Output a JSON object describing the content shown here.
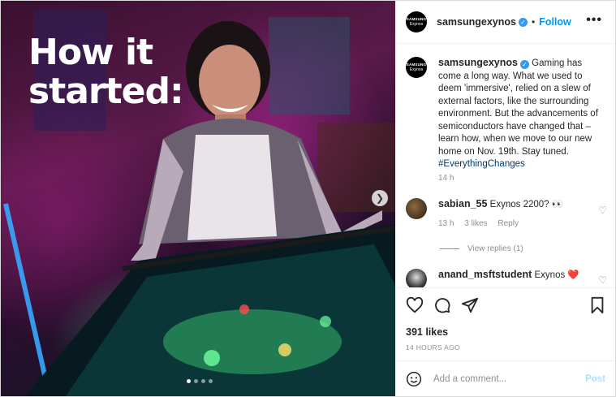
{
  "post": {
    "headline_line1": "How it",
    "headline_line2": "started:",
    "carousel_dots": 4,
    "active_dot": 1
  },
  "header": {
    "avatar_text_top": "SAMSUNG",
    "avatar_text_bottom": "Exynos",
    "username": "samsungexynos",
    "separator": "•",
    "follow_label": "Follow",
    "more_label": "•••"
  },
  "caption": {
    "username": "samsungexynos",
    "text": "Gaming has come a long way. What we used to deem 'immersive', relied on a slew of external factors, like the surrounding environment. But the advancements of semiconductors have changed that – learn how, when we move to our new home on Nov. 19th. Stay tuned.",
    "hashtag": "#EverythingChanges",
    "time": "14 h"
  },
  "comments": [
    {
      "username": "sabian_55",
      "text": "Exynos 2200? 👀",
      "time": "13 h",
      "likes": "3 likes",
      "reply_label": "Reply",
      "view_replies": "View replies (1)"
    },
    {
      "username": "anand_msftstudent",
      "text": "Exynos ❤️"
    }
  ],
  "actions": {
    "likes": "391 likes",
    "posted_ago": "14 HOURS AGO"
  },
  "add_comment": {
    "placeholder": "Add a comment...",
    "post_label": "Post"
  },
  "icons": {
    "like": "heart-icon",
    "comment": "comment-icon",
    "share": "share-icon",
    "save": "bookmark-icon",
    "emoji": "emoji-icon",
    "next": "chevron-right-icon",
    "verified": "verified-badge-icon"
  },
  "colors": {
    "link_blue": "#0095f6",
    "verified_blue": "#3897f0",
    "hashtag": "#00376b",
    "muted": "#8e8e8e",
    "post_disabled": "#b2dffc"
  }
}
